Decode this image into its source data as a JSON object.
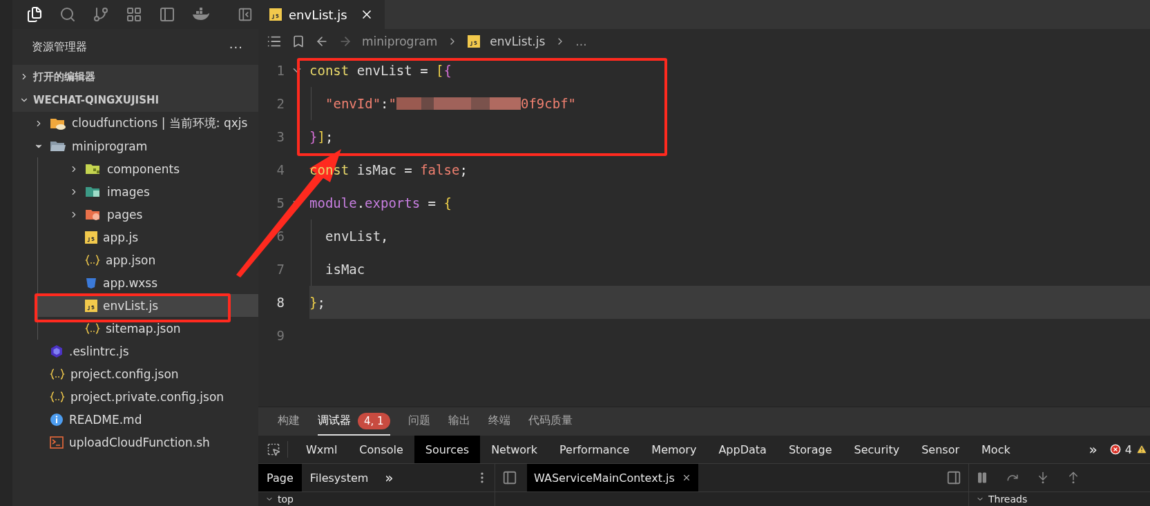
{
  "editor_tabs": [
    {
      "label": "envList.js",
      "kind": "js",
      "selected": true
    }
  ],
  "sidebar": {
    "title": "资源管理器",
    "more": "···",
    "sections": [
      {
        "label": "打开的编辑器",
        "expanded": false
      },
      {
        "label": "WECHAT-QINGXUJISHI",
        "expanded": true,
        "children": [
          {
            "label": "cloudfunctions | 当前环境: qxjs",
            "kind": "cloud-folder",
            "expanded": false,
            "selected": false
          },
          {
            "label": "miniprogram",
            "kind": "folder",
            "expanded": true,
            "selected": false,
            "children": [
              {
                "label": "components",
                "kind": "components-folder",
                "expanded": false,
                "selected": false
              },
              {
                "label": "images",
                "kind": "images-folder",
                "expanded": false,
                "selected": false
              },
              {
                "label": "pages",
                "kind": "pages-folder",
                "expanded": false,
                "selected": false
              },
              {
                "label": "app.js",
                "kind": "js",
                "selected": false
              },
              {
                "label": "app.json",
                "kind": "json",
                "selected": false
              },
              {
                "label": "app.wxss",
                "kind": "css",
                "selected": false
              },
              {
                "label": "envList.js",
                "kind": "js",
                "selected": true
              },
              {
                "label": "sitemap.json",
                "kind": "json",
                "selected": false
              }
            ]
          },
          {
            "label": ".eslintrc.js",
            "kind": "eslint",
            "selected": false
          },
          {
            "label": "project.config.json",
            "kind": "json",
            "selected": false
          },
          {
            "label": "project.private.config.json",
            "kind": "json",
            "selected": false
          },
          {
            "label": "README.md",
            "kind": "info",
            "selected": false
          },
          {
            "label": "uploadCloudFunction.sh",
            "kind": "shell",
            "selected": false
          }
        ]
      }
    ]
  },
  "breadcrumb": [
    {
      "label": "miniprogram",
      "kind": "folder"
    },
    {
      "label": "envList.js",
      "kind": "js"
    },
    {
      "label": "...",
      "kind": "more"
    }
  ],
  "code_lines": [
    {
      "number": "1",
      "fold": true,
      "current": false,
      "tokens": [
        {
          "kind": "keyword",
          "text": "const"
        },
        {
          "kind": "ident",
          "text": " envList "
        },
        {
          "kind": "op",
          "text": "= "
        },
        {
          "kind": "bracket1",
          "text": "["
        },
        {
          "kind": "bracket2",
          "text": "{"
        }
      ]
    },
    {
      "number": "2",
      "fold": false,
      "current": false,
      "indent_guide": true,
      "tokens": [
        {
          "kind": "string",
          "text": "\"envId\""
        },
        {
          "kind": "op",
          "text": ":"
        },
        {
          "kind": "string",
          "text": "\""
        },
        {
          "kind": "redacted"
        },
        {
          "kind": "string",
          "text": "0f9cbf\""
        }
      ]
    },
    {
      "number": "3",
      "fold": false,
      "current": false,
      "tokens": [
        {
          "kind": "bracket2",
          "text": "}"
        },
        {
          "kind": "bracket1",
          "text": "]"
        },
        {
          "kind": "op",
          "text": ";"
        }
      ]
    },
    {
      "number": "4",
      "fold": false,
      "current": false,
      "tokens": [
        {
          "kind": "keyword",
          "text": "const"
        },
        {
          "kind": "ident",
          "text": " isMac "
        },
        {
          "kind": "op",
          "text": "= "
        },
        {
          "kind": "literal",
          "text": "false"
        },
        {
          "kind": "op",
          "text": ";"
        }
      ]
    },
    {
      "number": "5",
      "fold": true,
      "current": false,
      "tokens": [
        {
          "kind": "member",
          "text": "module"
        },
        {
          "kind": "op",
          "text": "."
        },
        {
          "kind": "member",
          "text": "exports"
        },
        {
          "kind": "op",
          "text": " = "
        },
        {
          "kind": "bracket1",
          "text": "{"
        }
      ]
    },
    {
      "number": "6",
      "fold": false,
      "current": false,
      "indent_guide": true,
      "tokens": [
        {
          "kind": "ident",
          "text": "envList"
        },
        {
          "kind": "op",
          "text": ","
        }
      ]
    },
    {
      "number": "7",
      "fold": false,
      "current": false,
      "indent_guide": true,
      "tokens": [
        {
          "kind": "ident",
          "text": "isMac"
        }
      ]
    },
    {
      "number": "8",
      "fold": false,
      "current": true,
      "tokens": [
        {
          "kind": "bracket1",
          "text": "}"
        },
        {
          "kind": "op",
          "text": ";"
        }
      ]
    },
    {
      "number": "9",
      "fold": false,
      "current": false
    }
  ],
  "panel_tabs": [
    {
      "label": "构建",
      "selected": false
    },
    {
      "label": "调试器",
      "selected": true,
      "badge": "4, 1"
    },
    {
      "label": "问题",
      "selected": false
    },
    {
      "label": "输出",
      "selected": false
    },
    {
      "label": "终端",
      "selected": false
    },
    {
      "label": "代码质量",
      "selected": false
    }
  ],
  "devtools_tabs": [
    {
      "label": "Wxml",
      "selected": false
    },
    {
      "label": "Console",
      "selected": false
    },
    {
      "label": "Sources",
      "selected": true
    },
    {
      "label": "Network",
      "selected": false
    },
    {
      "label": "Performance",
      "selected": false
    },
    {
      "label": "Memory",
      "selected": false
    },
    {
      "label": "AppData",
      "selected": false
    },
    {
      "label": "Storage",
      "selected": false
    },
    {
      "label": "Security",
      "selected": false
    },
    {
      "label": "Sensor",
      "selected": false
    },
    {
      "label": "Mock",
      "selected": false
    }
  ],
  "devtools_more": "»",
  "error_count": "4",
  "sources": {
    "navigator_tabs": [
      {
        "label": "Page",
        "selected": true
      },
      {
        "label": "Filesystem",
        "selected": false
      }
    ],
    "navigator_more": "»",
    "tree_root": "top",
    "open_file": "WAServiceMainContext.js",
    "debugger_section": "Threads"
  }
}
